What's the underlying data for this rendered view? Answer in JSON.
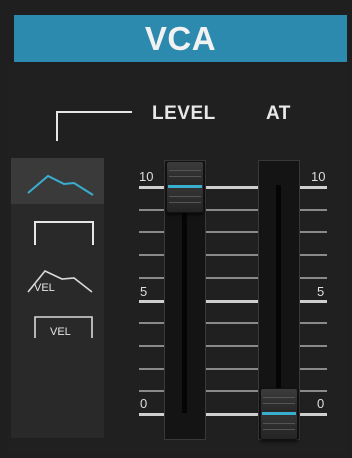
{
  "module": {
    "title": "VCA"
  },
  "headers": {
    "level": "LEVEL",
    "at": "AT"
  },
  "modes": {
    "selected": "envelope",
    "vel_labels": [
      "VEL",
      "VEL"
    ]
  },
  "scale": {
    "left": {
      "top": "10",
      "mid": "5",
      "bottom": "0"
    },
    "right": {
      "top": "10",
      "mid": "5",
      "bottom": "0"
    }
  },
  "sliders": {
    "level": {
      "value": 10,
      "max": 10
    },
    "at": {
      "value": 0,
      "max": 10
    }
  },
  "colors": {
    "title_bg": "#2b8aae",
    "accent": "#39aecf",
    "background": "#1f1f1f"
  }
}
